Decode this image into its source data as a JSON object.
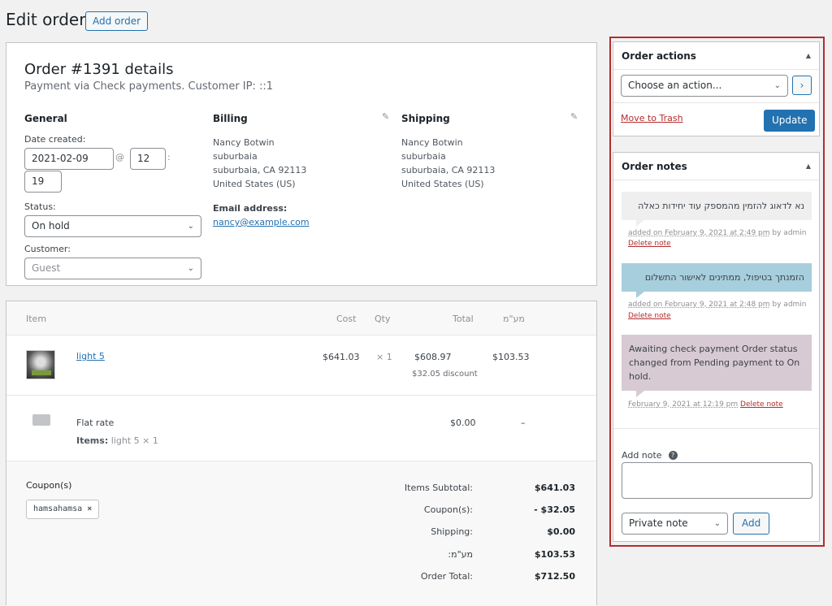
{
  "page": {
    "title": "Edit order",
    "add_order_label": "Add order"
  },
  "details": {
    "heading": "Order #1391 details",
    "subheading": "Payment via Check payments. Customer IP: ::1",
    "general": {
      "title": "General",
      "date_label": "Date created:",
      "date_value": "2021-02-09",
      "at": "@",
      "hour": "12",
      "colon": ":",
      "minute": "19",
      "status_label": "Status:",
      "status_value": "On hold",
      "customer_label": "Customer:",
      "customer_value": "Guest"
    },
    "billing": {
      "title": "Billing",
      "lines": [
        "Nancy Botwin",
        "suburbaia",
        "suburbaia, CA 92113",
        "United States (US)"
      ],
      "email_label": "Email address:",
      "email": "nancy@example.com"
    },
    "shipping": {
      "title": "Shipping",
      "lines": [
        "Nancy Botwin",
        "suburbaia",
        "suburbaia, CA 92113",
        "United States (US)"
      ]
    }
  },
  "items": {
    "headers": {
      "item": "Item",
      "cost": "Cost",
      "qty": "Qty",
      "total": "Total",
      "tax": "מע\"מ"
    },
    "line": {
      "name": "light 5",
      "cost": "$641.03",
      "qty": "× 1",
      "total": "$608.97",
      "discount": "$32.05 discount",
      "tax": "$103.53"
    },
    "shipping": {
      "name": "Flat rate",
      "items_label": "Items:",
      "items_value": "light 5 × 1",
      "total": "$0.00",
      "tax": "–"
    },
    "coupons_label": "Coupon(s)",
    "coupon_code": "hamsahamsa",
    "coupon_remove": "×",
    "totals": [
      {
        "label": "Items Subtotal:",
        "value": "$641.03"
      },
      {
        "label": "Coupon(s):",
        "value": "- $32.05"
      },
      {
        "label": "Shipping:",
        "value": "$0.00"
      },
      {
        "label": "מע\"מ:",
        "value": "$103.53"
      },
      {
        "label": "Order Total:",
        "value": "$712.50"
      }
    ]
  },
  "order_actions": {
    "title": "Order actions",
    "collapse_glyph": "▲",
    "select_value": "Choose an action...",
    "go_glyph": "›",
    "trash_label": "Move to Trash",
    "update_label": "Update"
  },
  "order_notes": {
    "title": "Order notes",
    "collapse_glyph": "▲",
    "notes": [
      {
        "text": "נא לדאוג להזמין מהמספק עוד יחידות כאלה",
        "meta_date": "added on February 9, 2021 at 2:49 pm",
        "meta_by": " by admin",
        "delete": "Delete note",
        "color": "#efefef"
      },
      {
        "text": "הזמנתך בטיפול, ממתינים לאישור התשלום",
        "meta_date": "added on February 9, 2021 at 2:48 pm",
        "meta_by": " by admin",
        "delete": "Delete note",
        "color": "#a7cedc"
      },
      {
        "text": "Awaiting check payment Order status changed from Pending payment to On hold.",
        "meta_date": "February 9, 2021 at 12:19 pm",
        "delete": "Delete note",
        "color": "#d7cad2"
      }
    ],
    "add_note_label": "Add note",
    "help_glyph": "?",
    "note_type_value": "Private note",
    "add_label": "Add"
  }
}
